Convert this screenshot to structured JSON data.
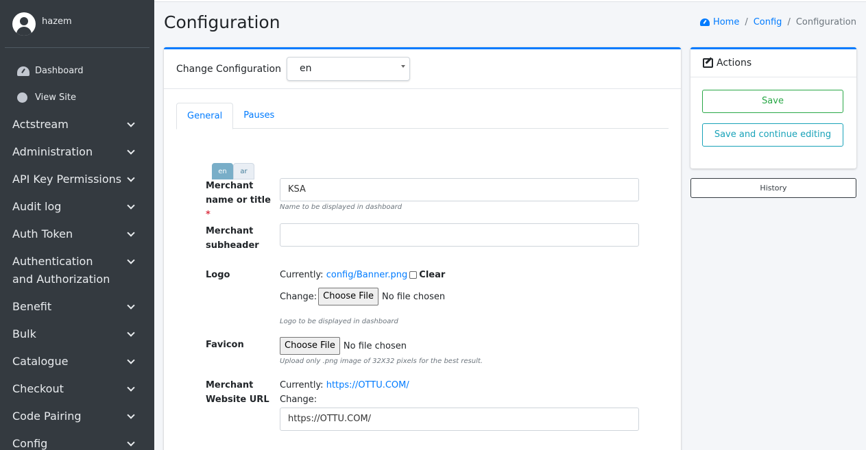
{
  "user": {
    "name": "hazem"
  },
  "sidebar": {
    "links": [
      {
        "label": "Dashboard",
        "icon": "dashboard-gauge-icon"
      },
      {
        "label": "View Site",
        "icon": "circle-icon"
      }
    ],
    "items": [
      {
        "label": "Actstream"
      },
      {
        "label": "Administration"
      },
      {
        "label": "API Key Permissions"
      },
      {
        "label": "Audit log"
      },
      {
        "label": "Auth Token"
      },
      {
        "label": "Authentication and Authorization"
      },
      {
        "label": "Benefit"
      },
      {
        "label": "Bulk"
      },
      {
        "label": "Catalogue"
      },
      {
        "label": "Checkout"
      },
      {
        "label": "Code Pairing"
      },
      {
        "label": "Config"
      }
    ]
  },
  "header": {
    "title": "Configuration",
    "breadcrumb": {
      "home": "Home",
      "config": "Config",
      "current": "Configuration",
      "sep": "/"
    }
  },
  "main": {
    "change_label": "Change Configuration",
    "language_value": "en",
    "tabs": [
      {
        "label": "General"
      },
      {
        "label": "Pauses"
      }
    ],
    "lang_tabs": [
      {
        "label": "en"
      },
      {
        "label": "ar"
      }
    ],
    "fields": {
      "merchant_name": {
        "label_line1": "Merchant",
        "label_line2": "name or title",
        "required": "*",
        "value": "KSA",
        "help": "Name to be displayed in dashboard"
      },
      "merchant_subheader": {
        "label_line1": "Merchant",
        "label_line2": "subheader",
        "value": ""
      },
      "logo": {
        "label": "Logo",
        "currently": "Currently:",
        "link": "config/Banner.png",
        "clear": "Clear",
        "change": "Change:",
        "choose": "Choose File",
        "no_file": "No file chosen",
        "help": "Logo to be displayed in dashboard"
      },
      "favicon": {
        "label": "Favicon",
        "choose": "Choose File",
        "no_file": "No file chosen",
        "help": "Upload only .png image of 32X32 pixels for the best result."
      },
      "website_url": {
        "label_line1": "Merchant",
        "label_line2": "Website URL",
        "currently": "Currently:",
        "link": "https://OTTU.COM/",
        "change": "Change:",
        "value": "https://OTTU.COM/"
      }
    }
  },
  "actions": {
    "title": "Actions",
    "save": "Save",
    "save_continue": "Save and continue editing",
    "history": "History"
  },
  "colors": {
    "sidebar": "#343a40",
    "primary": "#007bff",
    "success": "#28a745",
    "info": "#17a2b8"
  }
}
